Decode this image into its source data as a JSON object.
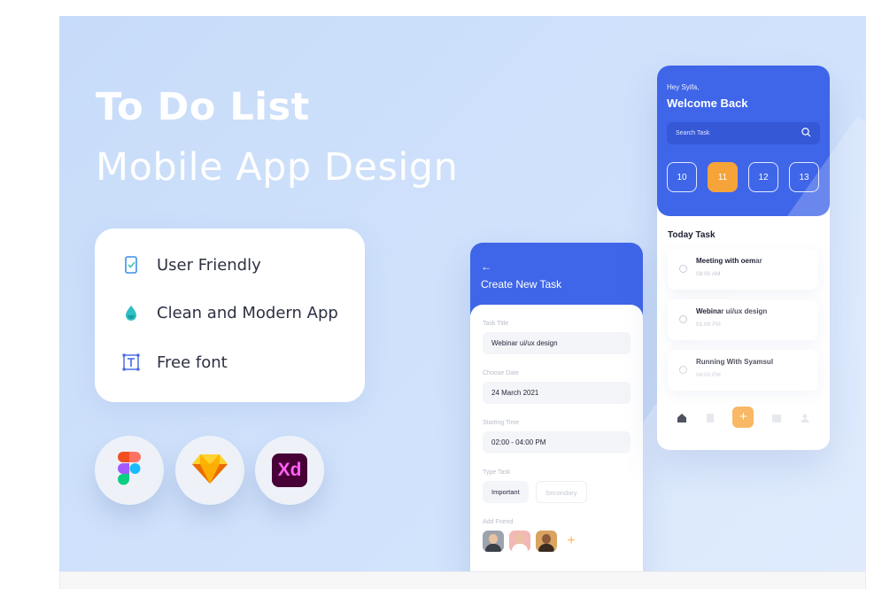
{
  "hero": {
    "line1": "To Do List",
    "line2": "Mobile App Design"
  },
  "features": [
    {
      "icon": "mobile-check-icon",
      "label": "User Friendly"
    },
    {
      "icon": "drop-icon",
      "label": "Clean and Modern App"
    },
    {
      "icon": "text-tool-icon",
      "label": "Free font"
    }
  ],
  "tools": [
    {
      "icon": "figma-logo-icon"
    },
    {
      "icon": "sketch-logo-icon"
    },
    {
      "icon": "xd-logo-icon",
      "label": "Xd"
    }
  ],
  "create_task": {
    "back": "←",
    "title": "Create New Task",
    "task_title_label": "Task Title",
    "task_title_value": "Webinar ui/ux design",
    "date_label": "Choose Date",
    "date_value": "24 March 2021",
    "time_label": "Starting Time",
    "time_value": "02:00 - 04:00 PM",
    "type_label": "Type Task",
    "type_important": "Important",
    "type_secondary": "Secondary",
    "friend_label": "Add Friend",
    "add_friend": "+"
  },
  "welcome": {
    "greeting": "Hey Syifa,",
    "title": "Welcome Back",
    "search_placeholder": "Search Task",
    "dates": [
      "10",
      "11",
      "12",
      "13"
    ],
    "active_date": "11",
    "today_title": "Today Task",
    "tasks": [
      {
        "title": "Meeting with oemar",
        "time": "08:00 AM"
      },
      {
        "title": "Webinar ui/ux design",
        "time": "01:00 PM"
      },
      {
        "title": "Running With Syamsul",
        "time": "04:00 PM"
      }
    ],
    "add_button": "+"
  },
  "colors": {
    "primary": "#3f66e8",
    "accent": "#f6a43a",
    "background": "#cfe1fb"
  }
}
